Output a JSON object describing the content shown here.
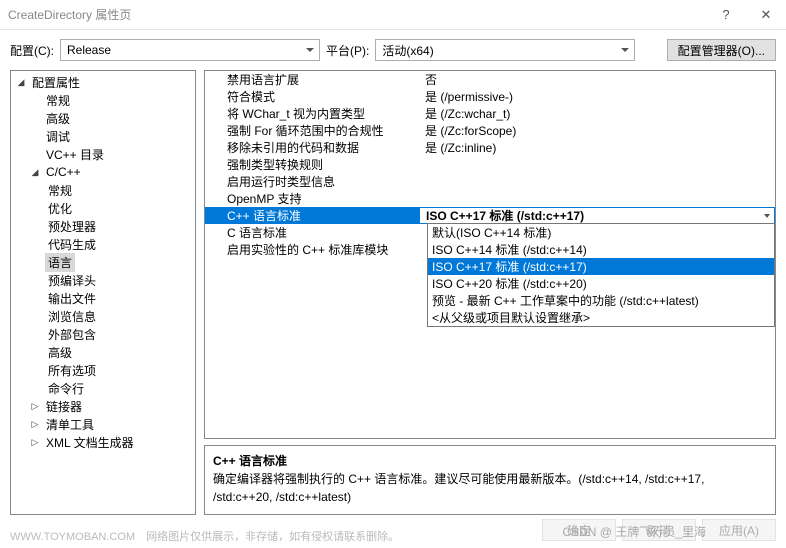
{
  "titlebar": {
    "title": "CreateDirectory 属性页",
    "help": "?",
    "close": "✕"
  },
  "config": {
    "config_label": "配置(C):",
    "config_value": "Release",
    "platform_label": "平台(P):",
    "platform_value": "活动(x64)",
    "manager_btn": "配置管理器(O)..."
  },
  "tree": {
    "root": "配置属性",
    "items1": [
      "常规",
      "高级",
      "调试",
      "VC++ 目录"
    ],
    "cpp": "C/C++",
    "cpp_items": [
      "常规",
      "优化",
      "预处理器",
      "代码生成",
      "语言",
      "预编译头",
      "输出文件",
      "浏览信息",
      "外部包含",
      "高级",
      "所有选项",
      "命令行"
    ],
    "linker": "链接器",
    "manifest": "清单工具",
    "xml": "XML 文档生成器"
  },
  "props": [
    {
      "name": "禁用语言扩展",
      "value": "否"
    },
    {
      "name": "符合模式",
      "value": "是 (/permissive-)"
    },
    {
      "name": "将 WChar_t 视为内置类型",
      "value": "是 (/Zc:wchar_t)"
    },
    {
      "name": "强制 For 循环范围中的合规性",
      "value": "是 (/Zc:forScope)"
    },
    {
      "name": "移除未引用的代码和数据",
      "value": "是 (/Zc:inline)"
    },
    {
      "name": "强制类型转换规则",
      "value": ""
    },
    {
      "name": "启用运行时类型信息",
      "value": ""
    },
    {
      "name": "OpenMP 支持",
      "value": ""
    },
    {
      "name": "C++ 语言标准",
      "value": "ISO C++17 标准 (/std:c++17)"
    },
    {
      "name": "C 语言标准",
      "value": ""
    },
    {
      "name": "启用实验性的 C++ 标准库模块",
      "value": ""
    }
  ],
  "dropdown": [
    "默认(ISO C++14 标准)",
    "ISO C++14 标准 (/std:c++14)",
    "ISO C++17 标准 (/std:c++17)",
    "ISO C++20 标准 (/std:c++20)",
    "预览 - 最新 C++ 工作草案中的功能 (/std:c++latest)",
    "<从父级或项目默认设置继承>"
  ],
  "desc": {
    "title": "C++ 语言标准",
    "text": "确定编译器将强制执行的 C++ 语言标准。建议尽可能使用最新版本。(/std:c++14, /std:c++17, /std:c++20, /std:c++latest)"
  },
  "buttons": {
    "ok": "确定",
    "cancel": "取消",
    "apply": "应用(A)"
  },
  "watermark": "WWW.TOYMOBAN.COM　网络图片仅供展示，非存储，如有侵权请联系删除。",
  "watermark2": "CSDN @ 王牌飞行员_里海"
}
